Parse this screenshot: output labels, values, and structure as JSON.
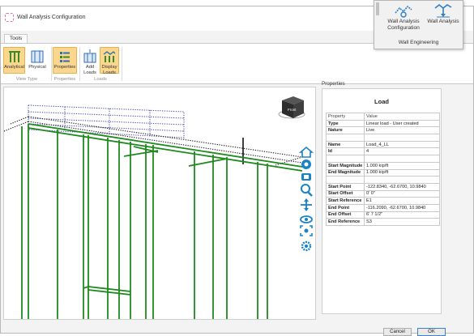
{
  "window": {
    "title": "Wall Analysis Configuration"
  },
  "ribbon": {
    "tab": "Tools",
    "buttons": {
      "analytical": "Analytical",
      "physical": "Physical",
      "properties": "Properties",
      "add_loads_1": "Add",
      "add_loads_2": "Loads",
      "display_loads_1": "Display",
      "display_loads_2": "Loads"
    },
    "groups": {
      "view_type": "View Type",
      "properties": "Properties",
      "loads": "Loads"
    }
  },
  "popout": {
    "config_1": "Wall Analysis",
    "config_2": "Configuration",
    "analysis": "Wall Analysis",
    "group": "Wall Engineering"
  },
  "properties": {
    "caption": "Properties",
    "heading": "Load",
    "columns": [
      "Property",
      "Value"
    ],
    "rows": [
      {
        "k": "Type",
        "v": "Linear load - User created"
      },
      {
        "k": "Nature",
        "v": "Live"
      },
      {
        "k": "",
        "v": ""
      },
      {
        "k": "Name",
        "v": "Load_4_LL"
      },
      {
        "k": "Id",
        "v": "4"
      },
      {
        "k": "",
        "v": ""
      },
      {
        "k": "Start Magnitude",
        "v": "1.000 kip/ft"
      },
      {
        "k": "End Magnitude",
        "v": "1.000 kip/ft"
      },
      {
        "k": "",
        "v": ""
      },
      {
        "k": "Start Point",
        "v": "-122.8340, -62.6700, 10.9840"
      },
      {
        "k": "Start Offset",
        "v": "0'  0\""
      },
      {
        "k": "Start Reference",
        "v": "E1"
      },
      {
        "k": "End Point",
        "v": "-116.2090, -62.6700, 10.9840"
      },
      {
        "k": "End Offset",
        "v": "6'  7 1/2\""
      },
      {
        "k": "End Reference",
        "v": "S3"
      }
    ]
  },
  "viewport": {
    "navcube_label": "Front"
  },
  "footer": {
    "cancel": "Cancel",
    "ok": "OK"
  },
  "colors": {
    "accent": "#fbd78d",
    "wall_green": "#1e8a1e",
    "load_blue": "#2a3d9c",
    "nav_blue": "#1b82c5"
  },
  "icons": [
    "navigation-cube-icon",
    "home-icon",
    "look-icon",
    "walk-icon",
    "zoom-icon",
    "pan-icon",
    "orbit-icon",
    "fit-icon",
    "settings-icon"
  ]
}
